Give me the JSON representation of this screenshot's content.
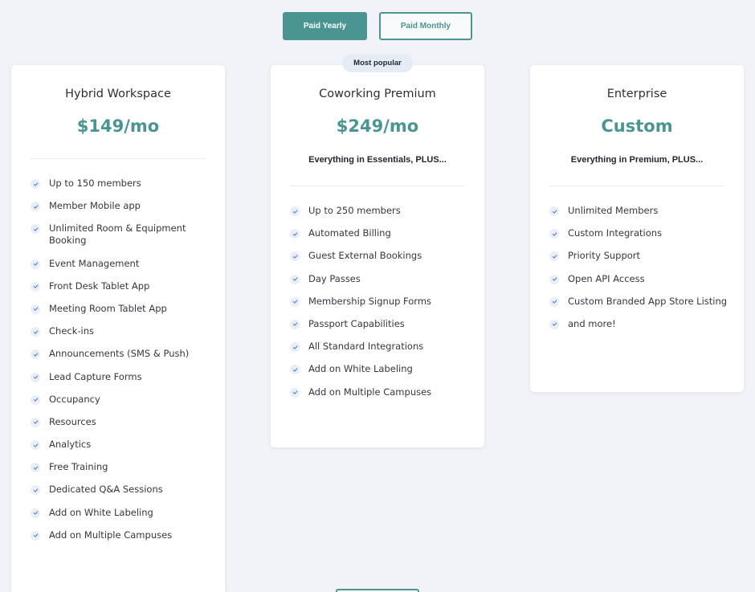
{
  "billing_toggle": {
    "yearly_label": "Paid Yearly",
    "monthly_label": "Paid Monthly"
  },
  "colors": {
    "accent": "#4a9592",
    "background": "#f1f3f8",
    "badge_bg": "#e6ecf6"
  },
  "plans": [
    {
      "name": "Hybrid Workspace",
      "price": "$149/mo",
      "tagline": "",
      "badge": "",
      "features": [
        "Up to 150 members",
        "Member Mobile app",
        "Unlimited Room & Equipment Booking",
        "Event Management",
        "Front Desk Tablet App",
        "Meeting Room Tablet App",
        "Check-ins",
        "Announcements (SMS & Push)",
        "Lead Capture Forms",
        "Occupancy",
        "Resources",
        "Analytics",
        "Free Training",
        "Dedicated Q&A Sessions",
        "Add on White Labeling",
        "Add on Multiple Campuses"
      ]
    },
    {
      "name": "Coworking Premium",
      "price": "$249/mo",
      "tagline": "Everything in Essentials, PLUS...",
      "badge": "Most popular",
      "features": [
        "Up to 250 members",
        "Automated Billing",
        "Guest External Bookings",
        "Day Passes",
        "Membership Signup Forms",
        "Passport Capabilities",
        "All Standard Integrations",
        "Add on White Labeling",
        "Add on Multiple Campuses"
      ]
    },
    {
      "name": "Enterprise",
      "price": "Custom",
      "tagline": "Everything in Premium, PLUS...",
      "badge": "",
      "features": [
        "Unlimited Members",
        "Custom Integrations",
        "Priority Support",
        "Open API Access",
        "Custom Branded App Store Listing",
        "and more!"
      ]
    }
  ],
  "icons": {
    "feature_check": "check-icon"
  }
}
